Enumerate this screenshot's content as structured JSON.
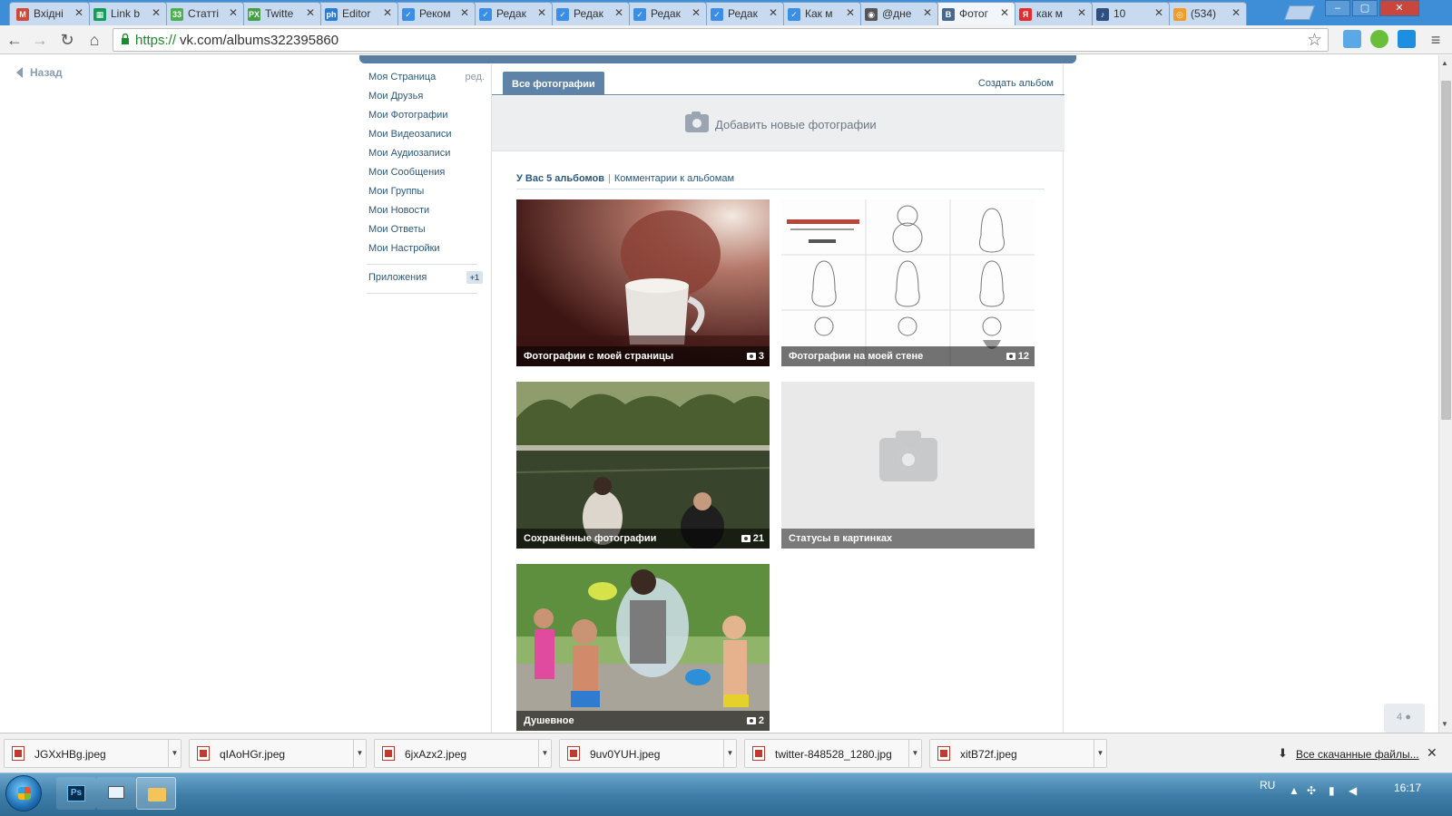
{
  "browser": {
    "tabs": [
      {
        "title": "Вхідні",
        "favicon": "gmail-icon",
        "color": "#d14836",
        "glyph": "M"
      },
      {
        "title": "Link b",
        "favicon": "sheets-icon",
        "color": "#0f9d58",
        "glyph": "▦"
      },
      {
        "title": "Статті",
        "favicon": "grid-icon",
        "color": "#4caf50",
        "glyph": "33"
      },
      {
        "title": "Twitte",
        "favicon": "px-icon",
        "color": "#43a047",
        "glyph": "PX"
      },
      {
        "title": "Editor",
        "favicon": "pho-icon",
        "color": "#2b7bd6",
        "glyph": "ph"
      },
      {
        "title": "Реком",
        "favicon": "check-icon",
        "color": "#3a8ee6",
        "glyph": "✓"
      },
      {
        "title": "Редак",
        "favicon": "check-icon",
        "color": "#3a8ee6",
        "glyph": "✓"
      },
      {
        "title": "Редак",
        "favicon": "check-icon",
        "color": "#3a8ee6",
        "glyph": "✓"
      },
      {
        "title": "Редак",
        "favicon": "check-icon",
        "color": "#3a8ee6",
        "glyph": "✓"
      },
      {
        "title": "Редак",
        "favicon": "check-icon",
        "color": "#3a8ee6",
        "glyph": "✓"
      },
      {
        "title": "Как м",
        "favicon": "check-icon",
        "color": "#3a8ee6",
        "glyph": "✓"
      },
      {
        "title": "@дне",
        "favicon": "chrome-icon",
        "color": "#555555",
        "glyph": "◉"
      },
      {
        "title": "Фотог",
        "favicon": "vk-icon",
        "color": "#45688e",
        "glyph": "B",
        "active": true
      },
      {
        "title": "как м",
        "favicon": "yandex-icon",
        "color": "#e62b2b",
        "glyph": "Я"
      },
      {
        "title": "10",
        "favicon": "audio-icon",
        "color": "#2f4f7f",
        "glyph": "♪"
      },
      {
        "title": "(534)",
        "favicon": "odnoklassniki-icon",
        "color": "#f59a23",
        "glyph": "◎"
      }
    ],
    "url_scheme": "https://",
    "url_rest": "vk.com/albums322395860"
  },
  "page": {
    "back_label": "Назад",
    "menu": [
      {
        "label": "Моя Страница",
        "name": "menu-my-page",
        "extra": "ред."
      },
      {
        "label": "Мои Друзья",
        "name": "menu-friends"
      },
      {
        "label": "Мои Фотографии",
        "name": "menu-photos"
      },
      {
        "label": "Мои Видеозаписи",
        "name": "menu-videos"
      },
      {
        "label": "Мои Аудиозаписи",
        "name": "menu-audio"
      },
      {
        "label": "Мои Сообщения",
        "name": "menu-messages"
      },
      {
        "label": "Мои Группы",
        "name": "menu-groups"
      },
      {
        "label": "Мои Новости",
        "name": "menu-news"
      },
      {
        "label": "Мои Ответы",
        "name": "menu-answers"
      },
      {
        "label": "Мои Настройки",
        "name": "menu-settings"
      }
    ],
    "apps": {
      "label": "Приложения",
      "badge": "+1"
    },
    "tab_all": "Все фотографии",
    "create_album": "Создать альбом",
    "add_photos": "Добавить новые фотографии",
    "summary": {
      "count": "У Вас 5 альбомов",
      "sep": "|",
      "comments": "Комментарии к альбомам"
    },
    "albums": [
      {
        "title": "Фотографии с моей страницы",
        "count": "3",
        "cover": "portrait-mug"
      },
      {
        "title": "Фотографии на моей стене",
        "count": "12",
        "cover": "matryoshka-sketch"
      },
      {
        "title": "Сохранённые фотографии",
        "count": "21",
        "cover": "lake"
      },
      {
        "title": "Статусы в картинках",
        "count": "",
        "cover": "empty"
      },
      {
        "title": "Душевное",
        "count": "2",
        "cover": "water-play"
      }
    ],
    "people_widget": "4"
  },
  "downloads": {
    "files": [
      "JGXxHBg.jpeg",
      "qIAoHGr.jpeg",
      "6jxAzx2.jpeg",
      "9uv0YUH.jpeg",
      "twitter-848528_1280.jpg",
      "xitB72f.jpeg"
    ],
    "all_label": "Все скачанные файлы..."
  },
  "taskbar": {
    "lang": "RU",
    "time": "16:17"
  }
}
